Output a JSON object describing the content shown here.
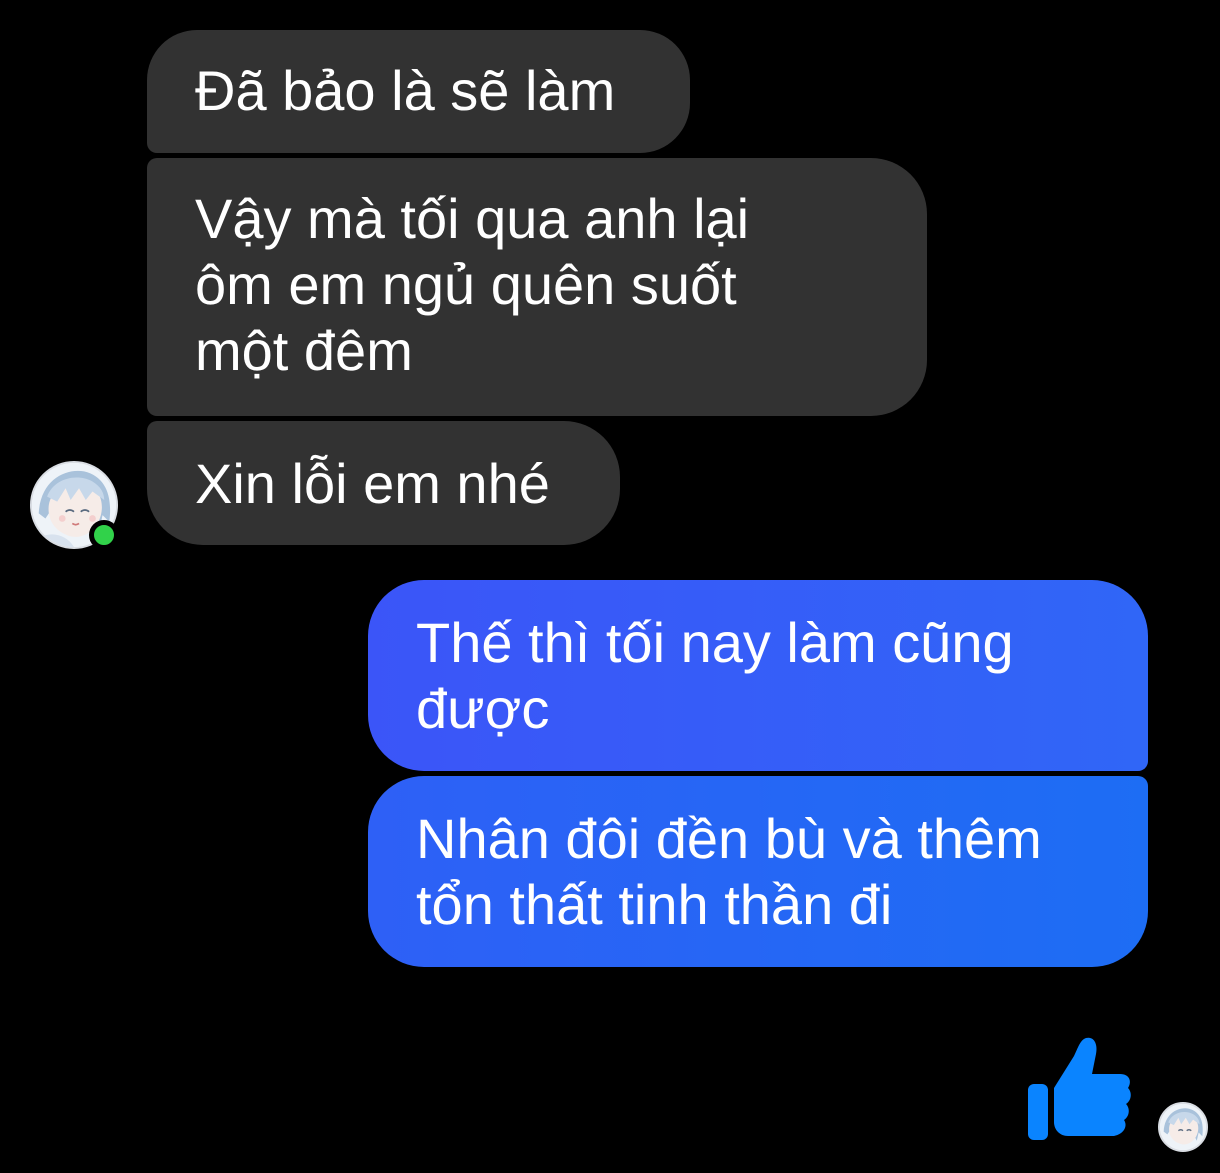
{
  "messages": [
    {
      "sender": "other",
      "text": "Đã bảo là sẽ làm"
    },
    {
      "sender": "other",
      "text": "Vậy mà tối qua anh lại\nôm em ngủ quên suốt\nmột đêm"
    },
    {
      "sender": "other",
      "text": "Xin lỗi em nhé"
    },
    {
      "sender": "self",
      "text": "Thế thì tối nay làm cũng\nđược"
    },
    {
      "sender": "self",
      "text": "Nhân đôi đền bù và thêm\ntổn thất tinh thần đi"
    }
  ],
  "contact": {
    "status": "online",
    "status_color": "#31d24a"
  },
  "reaction": {
    "icon": "thumbs-up-icon",
    "color": "#0a84ff"
  },
  "colors": {
    "background": "#000000",
    "incoming_bubble": "#323232",
    "outgoing_bubble": "#2f63f6",
    "text": "#ffffff"
  }
}
